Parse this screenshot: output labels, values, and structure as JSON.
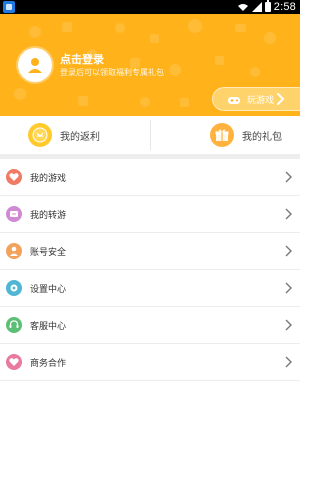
{
  "status_bar": {
    "time": "2:58"
  },
  "header": {
    "login_title": "点击登录",
    "login_subtitle": "登录后可以领取福利专属礼包",
    "play_button_label": "玩游戏"
  },
  "quick_actions": {
    "left_label": "我的返利",
    "right_label": "我的礼包"
  },
  "menu": {
    "items": [
      {
        "label": "我的游戏",
        "color": "#f07a63"
      },
      {
        "label": "我的转游",
        "color": "#d08ad3"
      },
      {
        "label": "账号安全",
        "color": "#f2a25b"
      },
      {
        "label": "设置中心",
        "color": "#4fb6d3"
      },
      {
        "label": "客服中心",
        "color": "#5cbf75"
      },
      {
        "label": "商务合作",
        "color": "#e87aa0"
      }
    ]
  },
  "colors": {
    "header_bg": "#ffb21a",
    "accent": "#ffca2e"
  }
}
